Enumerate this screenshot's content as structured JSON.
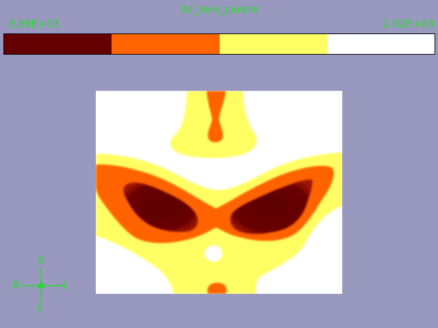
{
  "title": "3d_zero_centre",
  "colorbar": {
    "min_label": "-3.69E+03",
    "max_label": "2.02E+03",
    "segments": [
      "#640000",
      "#ff6400",
      "#ffff64",
      "#ffffff"
    ]
  },
  "orientation": {
    "superior": "S",
    "inferior": "I",
    "right": "R",
    "left": "L"
  },
  "colors": {
    "background": "#9999c0",
    "label": "#22dd22",
    "level_dark": "#640000",
    "level_orange": "#ff6400",
    "level_yellow": "#ffff64",
    "level_white": "#ffffff"
  }
}
